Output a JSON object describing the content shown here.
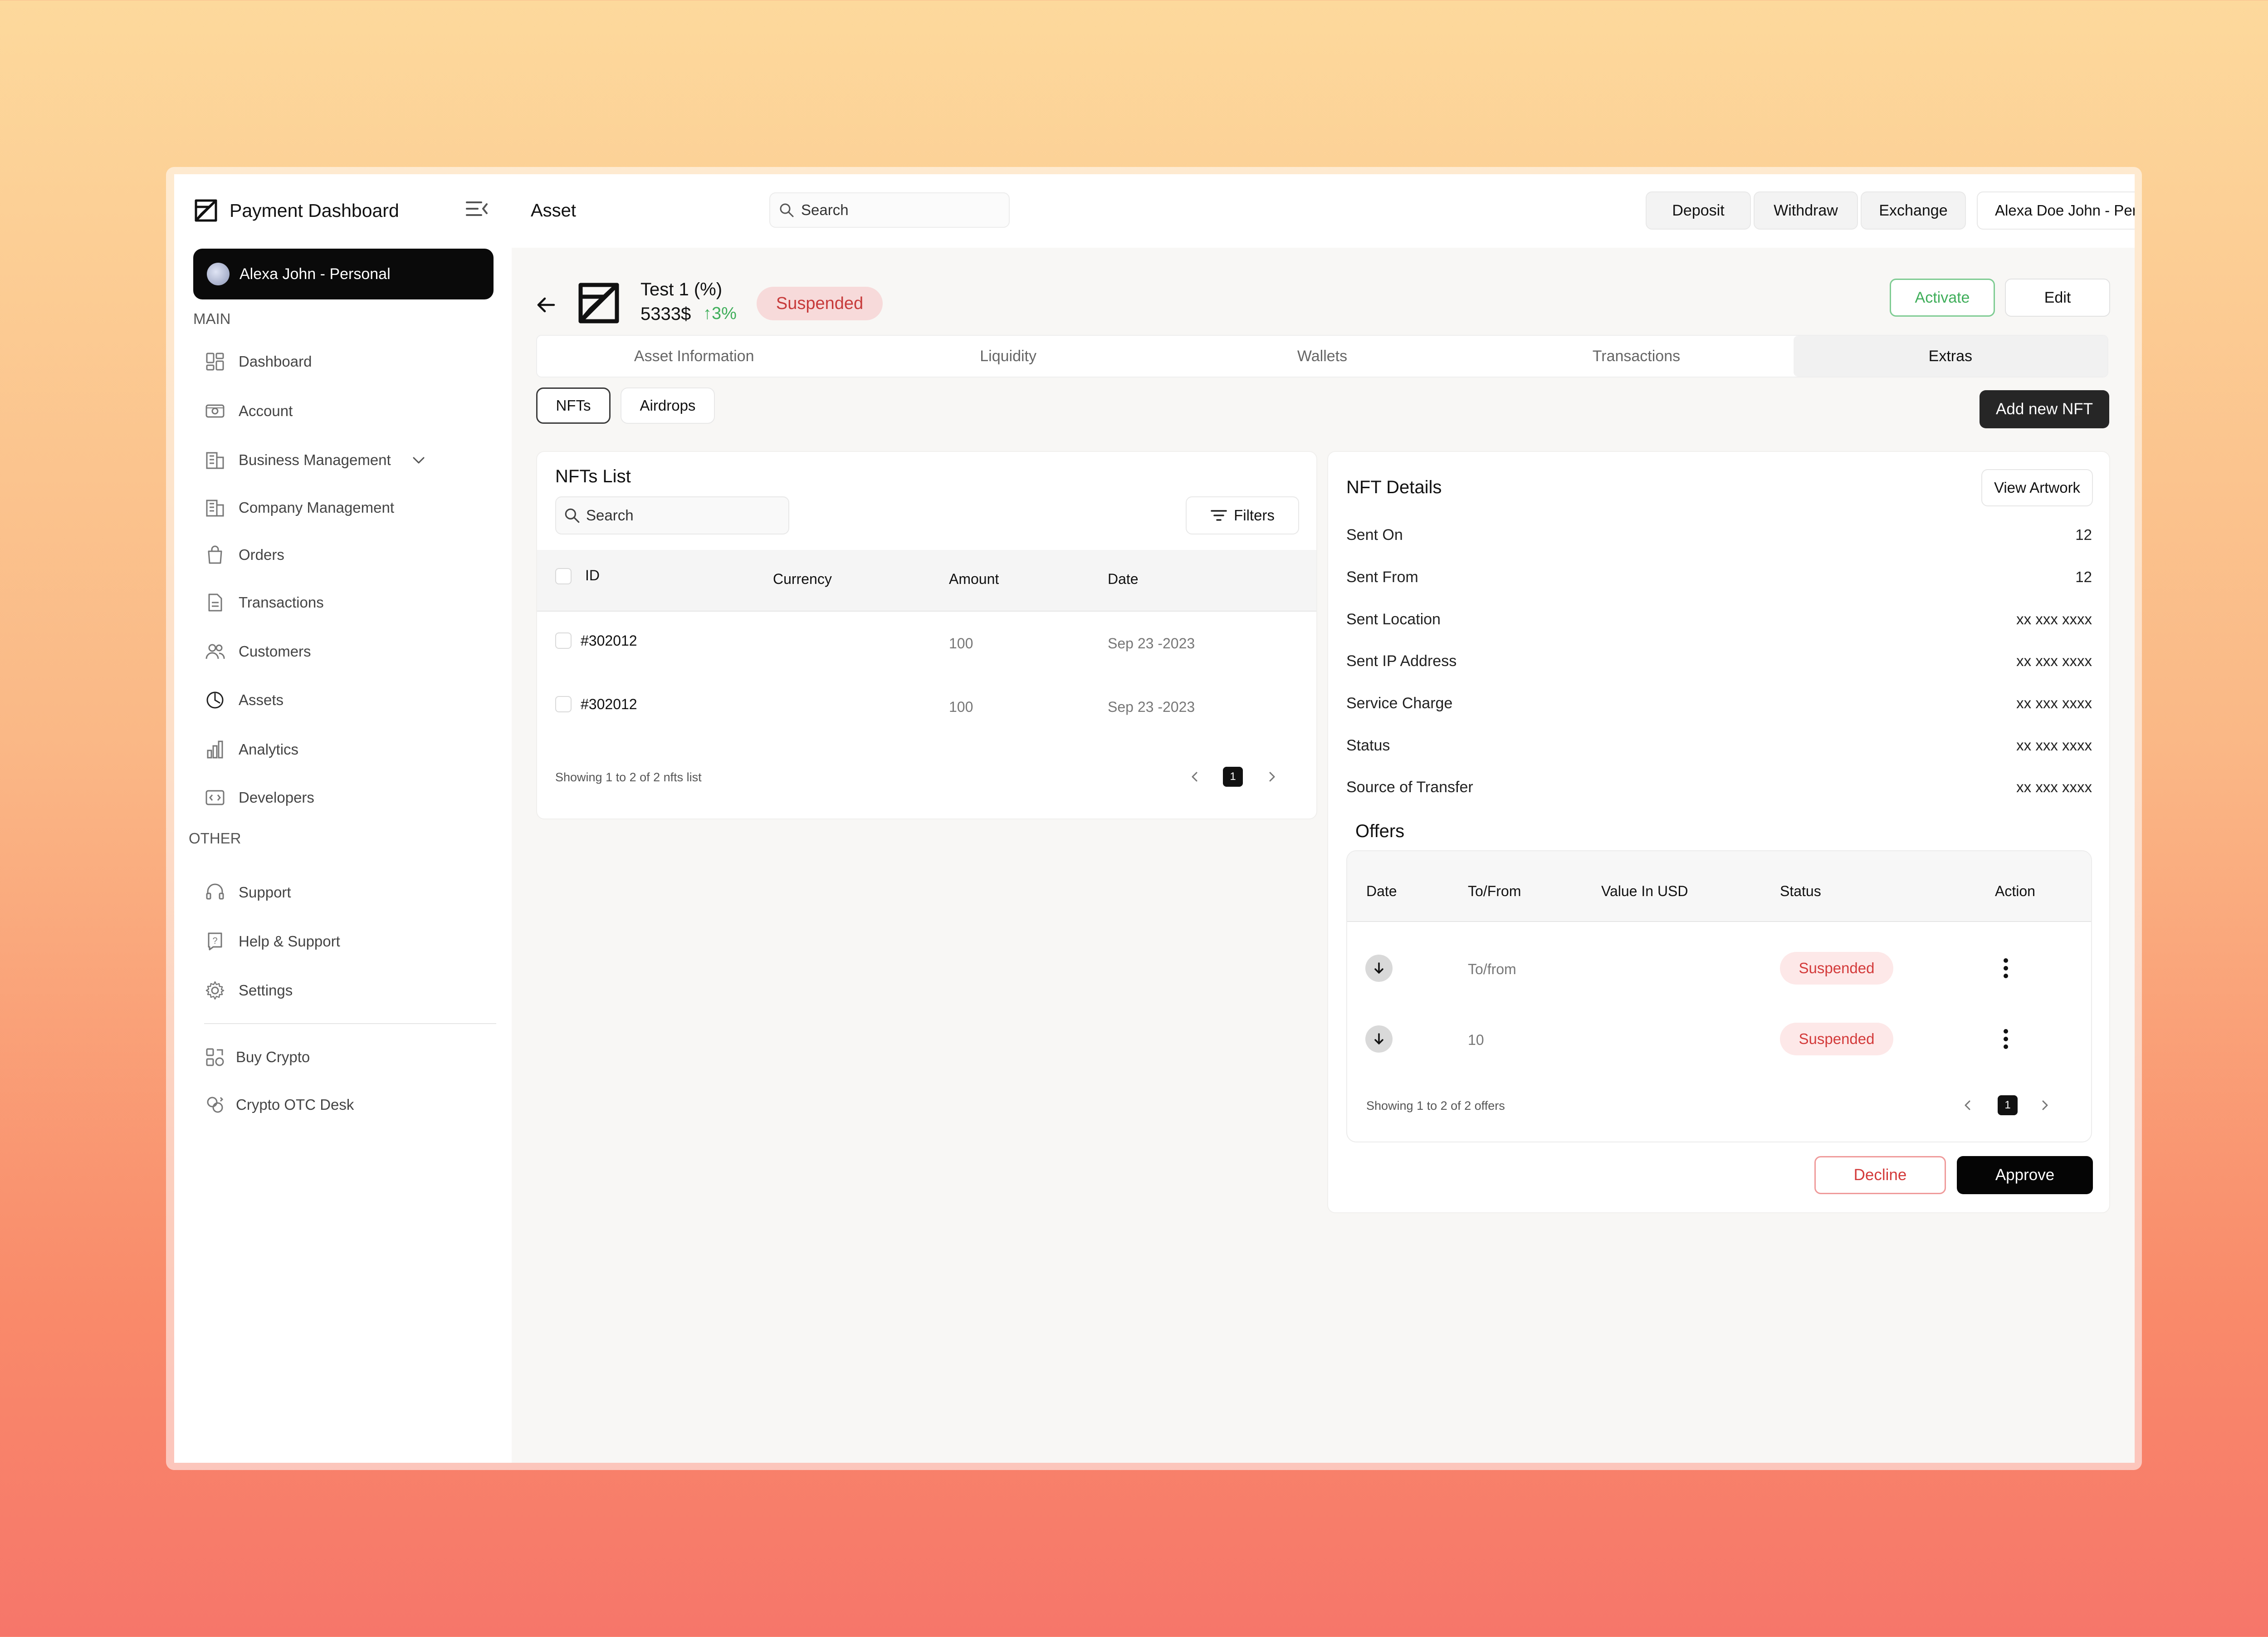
{
  "app": {
    "brand": "Payment Dashboard",
    "account_pill": "Alexa John - Personal"
  },
  "sidebar": {
    "main_label": "MAIN",
    "other_label": "OTHER",
    "main_items": [
      {
        "label": "Dashboard",
        "icon": "dashboard-icon"
      },
      {
        "label": "Account",
        "icon": "wallet-icon"
      },
      {
        "label": "Business Management",
        "icon": "building-icon"
      },
      {
        "label": "Company Management",
        "icon": "building-icon"
      },
      {
        "label": "Orders",
        "icon": "bag-icon"
      },
      {
        "label": "Transactions",
        "icon": "document-icon"
      },
      {
        "label": "Customers",
        "icon": "users-icon"
      },
      {
        "label": "Assets",
        "icon": "pie-chart-icon"
      },
      {
        "label": "Analytics",
        "icon": "bar-chart-icon"
      },
      {
        "label": "Developers",
        "icon": "code-icon"
      }
    ],
    "other_items": [
      {
        "label": "Support",
        "icon": "headset-icon"
      },
      {
        "label": "Help & Support",
        "icon": "help-icon"
      },
      {
        "label": "Settings",
        "icon": "gear-icon"
      }
    ],
    "extra_items": [
      {
        "label": "Buy Crypto",
        "icon": "crypto-icon"
      },
      {
        "label": "Crypto OTC Desk",
        "icon": "exchange-icon"
      }
    ]
  },
  "topbar": {
    "title": "Asset",
    "search_placeholder": "Search",
    "deposit": "Deposit",
    "withdraw": "Withdraw",
    "exchange": "Exchange",
    "account_select": "Alexa Doe John - Personal"
  },
  "asset": {
    "name": "Test 1 (%)",
    "price": "5333$",
    "change": "↑3%",
    "status": "Suspended",
    "activate": "Activate",
    "edit": "Edit"
  },
  "tabs": [
    "Asset Information",
    "Liquidity",
    "Wallets",
    "Transactions",
    "Extras"
  ],
  "active_tab": "Extras",
  "subtabs": {
    "nfts": "NFTs",
    "airdrops": "Airdrops"
  },
  "add_nft": "Add new NFT",
  "nft_list": {
    "title": "NFTs List",
    "search_placeholder": "Search",
    "filters": "Filters",
    "columns": {
      "id": "ID",
      "currency": "Currency",
      "amount": "Amount",
      "date": "Date"
    },
    "rows": [
      {
        "id": "#302012",
        "currency": "",
        "amount": "100",
        "date": "Sep 23 -2023"
      },
      {
        "id": "#302012",
        "currency": "",
        "amount": "100",
        "date": "Sep 23 -2023"
      }
    ],
    "footer": "Showing 1 to 2 of 2 nfts list",
    "page": "1"
  },
  "nft_details": {
    "title": "NFT Details",
    "view_artwork": "View Artwork",
    "fields": [
      {
        "label": "Sent On",
        "value": "12"
      },
      {
        "label": "Sent From",
        "value": "12"
      },
      {
        "label": "Sent Location",
        "value": "xx xxx xxxx"
      },
      {
        "label": "Sent IP Address",
        "value": "xx xxx xxxx"
      },
      {
        "label": "Service Charge",
        "value": "xx xxx xxxx"
      },
      {
        "label": "Status",
        "value": "xx xxx xxxx"
      },
      {
        "label": "Source of Transfer",
        "value": "xx xxx xxxx"
      }
    ],
    "offers": {
      "title": "Offers",
      "columns": {
        "date": "Date",
        "to_from": "To/From",
        "value_usd": "Value In USD",
        "status": "Status",
        "action": "Action"
      },
      "rows": [
        {
          "to_from": "To/from",
          "value_usd": "",
          "status": "Suspended"
        },
        {
          "to_from": "10",
          "value_usd": "",
          "status": "Suspended"
        }
      ],
      "footer": "Showing 1 to 2 of 2 offers",
      "page": "1"
    },
    "decline": "Decline",
    "approve": "Approve"
  },
  "colors": {
    "accent_dark": "#0a0a0a",
    "positive": "#3fae5a",
    "suspended_text": "#c73a3a",
    "suspended_bg": "#f7dada"
  }
}
